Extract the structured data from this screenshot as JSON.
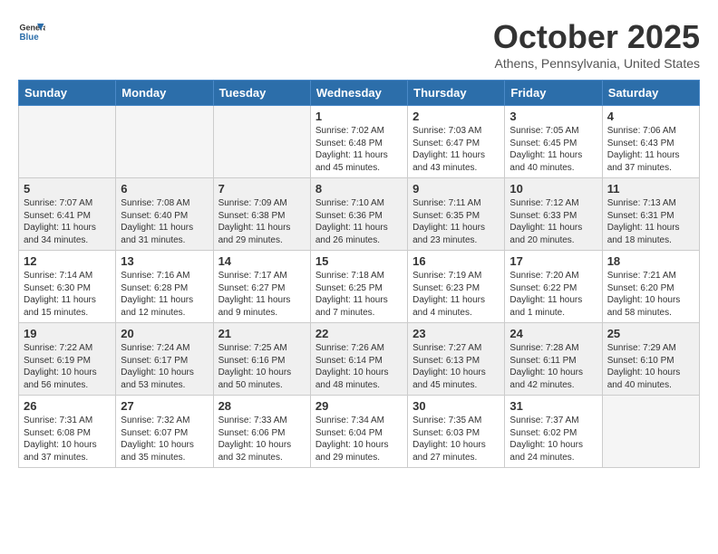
{
  "header": {
    "logo_general": "General",
    "logo_blue": "Blue",
    "month": "October 2025",
    "location": "Athens, Pennsylvania, United States"
  },
  "weekdays": [
    "Sunday",
    "Monday",
    "Tuesday",
    "Wednesday",
    "Thursday",
    "Friday",
    "Saturday"
  ],
  "weeks": [
    [
      {
        "day": "",
        "info": ""
      },
      {
        "day": "",
        "info": ""
      },
      {
        "day": "",
        "info": ""
      },
      {
        "day": "1",
        "info": "Sunrise: 7:02 AM\nSunset: 6:48 PM\nDaylight: 11 hours and 45 minutes."
      },
      {
        "day": "2",
        "info": "Sunrise: 7:03 AM\nSunset: 6:47 PM\nDaylight: 11 hours and 43 minutes."
      },
      {
        "day": "3",
        "info": "Sunrise: 7:05 AM\nSunset: 6:45 PM\nDaylight: 11 hours and 40 minutes."
      },
      {
        "day": "4",
        "info": "Sunrise: 7:06 AM\nSunset: 6:43 PM\nDaylight: 11 hours and 37 minutes."
      }
    ],
    [
      {
        "day": "5",
        "info": "Sunrise: 7:07 AM\nSunset: 6:41 PM\nDaylight: 11 hours and 34 minutes."
      },
      {
        "day": "6",
        "info": "Sunrise: 7:08 AM\nSunset: 6:40 PM\nDaylight: 11 hours and 31 minutes."
      },
      {
        "day": "7",
        "info": "Sunrise: 7:09 AM\nSunset: 6:38 PM\nDaylight: 11 hours and 29 minutes."
      },
      {
        "day": "8",
        "info": "Sunrise: 7:10 AM\nSunset: 6:36 PM\nDaylight: 11 hours and 26 minutes."
      },
      {
        "day": "9",
        "info": "Sunrise: 7:11 AM\nSunset: 6:35 PM\nDaylight: 11 hours and 23 minutes."
      },
      {
        "day": "10",
        "info": "Sunrise: 7:12 AM\nSunset: 6:33 PM\nDaylight: 11 hours and 20 minutes."
      },
      {
        "day": "11",
        "info": "Sunrise: 7:13 AM\nSunset: 6:31 PM\nDaylight: 11 hours and 18 minutes."
      }
    ],
    [
      {
        "day": "12",
        "info": "Sunrise: 7:14 AM\nSunset: 6:30 PM\nDaylight: 11 hours and 15 minutes."
      },
      {
        "day": "13",
        "info": "Sunrise: 7:16 AM\nSunset: 6:28 PM\nDaylight: 11 hours and 12 minutes."
      },
      {
        "day": "14",
        "info": "Sunrise: 7:17 AM\nSunset: 6:27 PM\nDaylight: 11 hours and 9 minutes."
      },
      {
        "day": "15",
        "info": "Sunrise: 7:18 AM\nSunset: 6:25 PM\nDaylight: 11 hours and 7 minutes."
      },
      {
        "day": "16",
        "info": "Sunrise: 7:19 AM\nSunset: 6:23 PM\nDaylight: 11 hours and 4 minutes."
      },
      {
        "day": "17",
        "info": "Sunrise: 7:20 AM\nSunset: 6:22 PM\nDaylight: 11 hours and 1 minute."
      },
      {
        "day": "18",
        "info": "Sunrise: 7:21 AM\nSunset: 6:20 PM\nDaylight: 10 hours and 58 minutes."
      }
    ],
    [
      {
        "day": "19",
        "info": "Sunrise: 7:22 AM\nSunset: 6:19 PM\nDaylight: 10 hours and 56 minutes."
      },
      {
        "day": "20",
        "info": "Sunrise: 7:24 AM\nSunset: 6:17 PM\nDaylight: 10 hours and 53 minutes."
      },
      {
        "day": "21",
        "info": "Sunrise: 7:25 AM\nSunset: 6:16 PM\nDaylight: 10 hours and 50 minutes."
      },
      {
        "day": "22",
        "info": "Sunrise: 7:26 AM\nSunset: 6:14 PM\nDaylight: 10 hours and 48 minutes."
      },
      {
        "day": "23",
        "info": "Sunrise: 7:27 AM\nSunset: 6:13 PM\nDaylight: 10 hours and 45 minutes."
      },
      {
        "day": "24",
        "info": "Sunrise: 7:28 AM\nSunset: 6:11 PM\nDaylight: 10 hours and 42 minutes."
      },
      {
        "day": "25",
        "info": "Sunrise: 7:29 AM\nSunset: 6:10 PM\nDaylight: 10 hours and 40 minutes."
      }
    ],
    [
      {
        "day": "26",
        "info": "Sunrise: 7:31 AM\nSunset: 6:08 PM\nDaylight: 10 hours and 37 minutes."
      },
      {
        "day": "27",
        "info": "Sunrise: 7:32 AM\nSunset: 6:07 PM\nDaylight: 10 hours and 35 minutes."
      },
      {
        "day": "28",
        "info": "Sunrise: 7:33 AM\nSunset: 6:06 PM\nDaylight: 10 hours and 32 minutes."
      },
      {
        "day": "29",
        "info": "Sunrise: 7:34 AM\nSunset: 6:04 PM\nDaylight: 10 hours and 29 minutes."
      },
      {
        "day": "30",
        "info": "Sunrise: 7:35 AM\nSunset: 6:03 PM\nDaylight: 10 hours and 27 minutes."
      },
      {
        "day": "31",
        "info": "Sunrise: 7:37 AM\nSunset: 6:02 PM\nDaylight: 10 hours and 24 minutes."
      },
      {
        "day": "",
        "info": ""
      }
    ]
  ]
}
